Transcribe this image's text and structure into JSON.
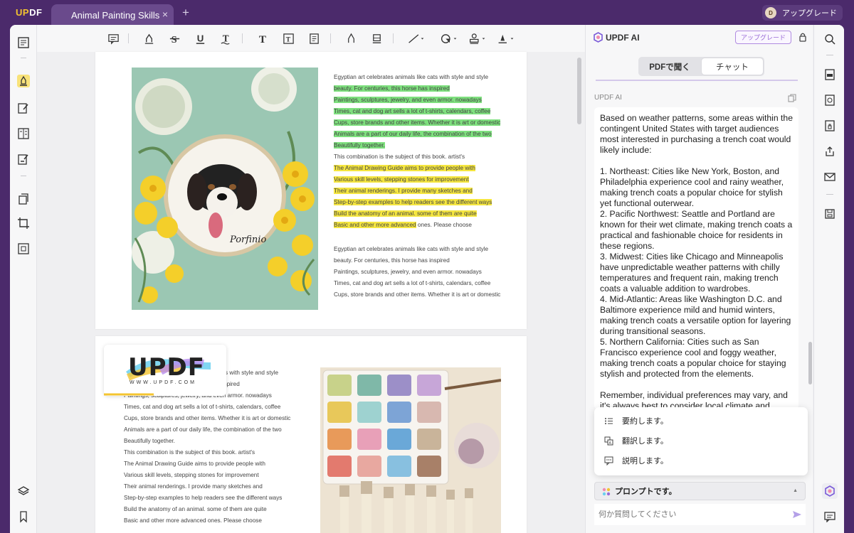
{
  "app": {
    "logo_u": "UP",
    "logo_rest": "DF",
    "tab_title": "Animal Painting Skills",
    "new_tab": "+",
    "tab_close": "×",
    "upgrade_label": "アップグレード",
    "avatar_initial": "D"
  },
  "document": {
    "page1_para1": [
      {
        "text": "Egyptian art celebrates animals like cats with style and style",
        "hl": ""
      },
      {
        "text": "beauty. For centuries, this horse has inspired",
        "hl": "green"
      },
      {
        "text": "Paintings, sculptures, jewelry, and even armor. nowadays",
        "hl": "green"
      },
      {
        "text": "Times, cat and dog art sells a lot of t-shirts, calendars, coffee",
        "hl": "green"
      },
      {
        "text": "Cups, store brands and other items. Whether it is art or domestic",
        "hl": "green"
      },
      {
        "text": "Animals are a part of our daily life, the combination of the two",
        "hl": "green"
      },
      {
        "text": "Beautifully together.",
        "hl": "green"
      },
      {
        "text": "This combination is the subject of this book. artist's",
        "hl": ""
      },
      {
        "text": "The Animal Drawing Guide aims to provide people with",
        "hl": "yellow"
      },
      {
        "text": "Various skill levels, stepping stones for improvement",
        "hl": "yellow"
      },
      {
        "text": "Their animal renderings. I provide many sketches and",
        "hl": "yellow"
      },
      {
        "text": "Step-by-step examples to help readers see the different ways",
        "hl": "yellow"
      },
      {
        "text": "Build the anatomy of an animal. some of them are quite",
        "hl": "yellow"
      },
      {
        "text": "Basic and other more advanced",
        "hl": "yellow",
        "tail": " ones. Please choose"
      }
    ],
    "page1_para2": [
      "Egyptian art celebrates animals like cats with style and style",
      "beauty. For centuries, this horse has inspired",
      "Paintings, sculptures, jewelry, and even armor. nowadays",
      "Times, cat and dog art sells a lot of t-shirts, calendars, coffee",
      "Cups, store brands and other items. Whether it is art or domestic"
    ],
    "page2_lines": [
      "Egyptian art celebrates animals like cats with style and style",
      "beauty. For centuries, this horse has inspired",
      "Paintings, sculptures, jewelry, and even armor. nowadays",
      "Times, cat and dog art sells a lot of t-shirts, calendars, coffee",
      "Cups, store brands and other items. Whether it is art or domestic",
      "Animals are a part of our daily life, the combination of the two",
      "Beautifully together.",
      "This combination is the subject of this book. artist's",
      "The Animal Drawing Guide aims to provide people with",
      "Various skill levels, stepping stones for improvement",
      "Their animal renderings. I provide many sketches and",
      "Step-by-step examples to help readers see the different ways",
      "Build the anatomy of an animal. some of them are quite",
      "Basic and other more advanced ones. Please choose"
    ],
    "embroidery_text": "Porfinio",
    "badge_word": "UPDF",
    "badge_url": "WWW.UPDF.COM"
  },
  "ai": {
    "title": "UPDF AI",
    "upgrade": "アップグレード",
    "tab_pdf": "PDFで聞く",
    "tab_chat": "チャット",
    "sender": "UPDF AI",
    "message": [
      "Based on weather patterns, some areas within the contingent United States with target audiences most interested in purchasing a trench coat would likely include:",
      "1. Northeast: Cities like New York, Boston, and Philadelphia experience cool and rainy weather, making trench coats a popular choice for stylish yet functional outerwear.",
      "2. Pacific Northwest: Seattle and Portland are known for their wet climate, making trench coats a practical and fashionable choice for residents in these regions.",
      "3. Midwest: Cities like Chicago and Minneapolis have unpredictable weather patterns with chilly temperatures and frequent rain, making trench coats a valuable addition to wardrobes.",
      "4. Mid-Atlantic: Areas like Washington D.C. and Baltimore experience mild and humid winters, making trench coats a versatile option for layering during transitional seasons.",
      "5. Northern California: Cities such as San Francisco experience cool and foggy weather, making trench coats a popular choice for staying stylish and protected from the elements.",
      "Remember, individual preferences may vary, and it's always best to consider local climate and"
    ],
    "menu": [
      {
        "label": "要約します。",
        "icon": "list-icon"
      },
      {
        "label": "翻訳します。",
        "icon": "translate-icon"
      },
      {
        "label": "説明します。",
        "icon": "explain-icon"
      }
    ],
    "prompt_label": "プロンプトです。",
    "input_placeholder": "何か質問してください"
  },
  "colors": {
    "accent": "#4b2a6b",
    "highlight_green": "#7ee07e",
    "highlight_yellow": "#f5e640",
    "ai_purple": "#9a6bd6"
  }
}
